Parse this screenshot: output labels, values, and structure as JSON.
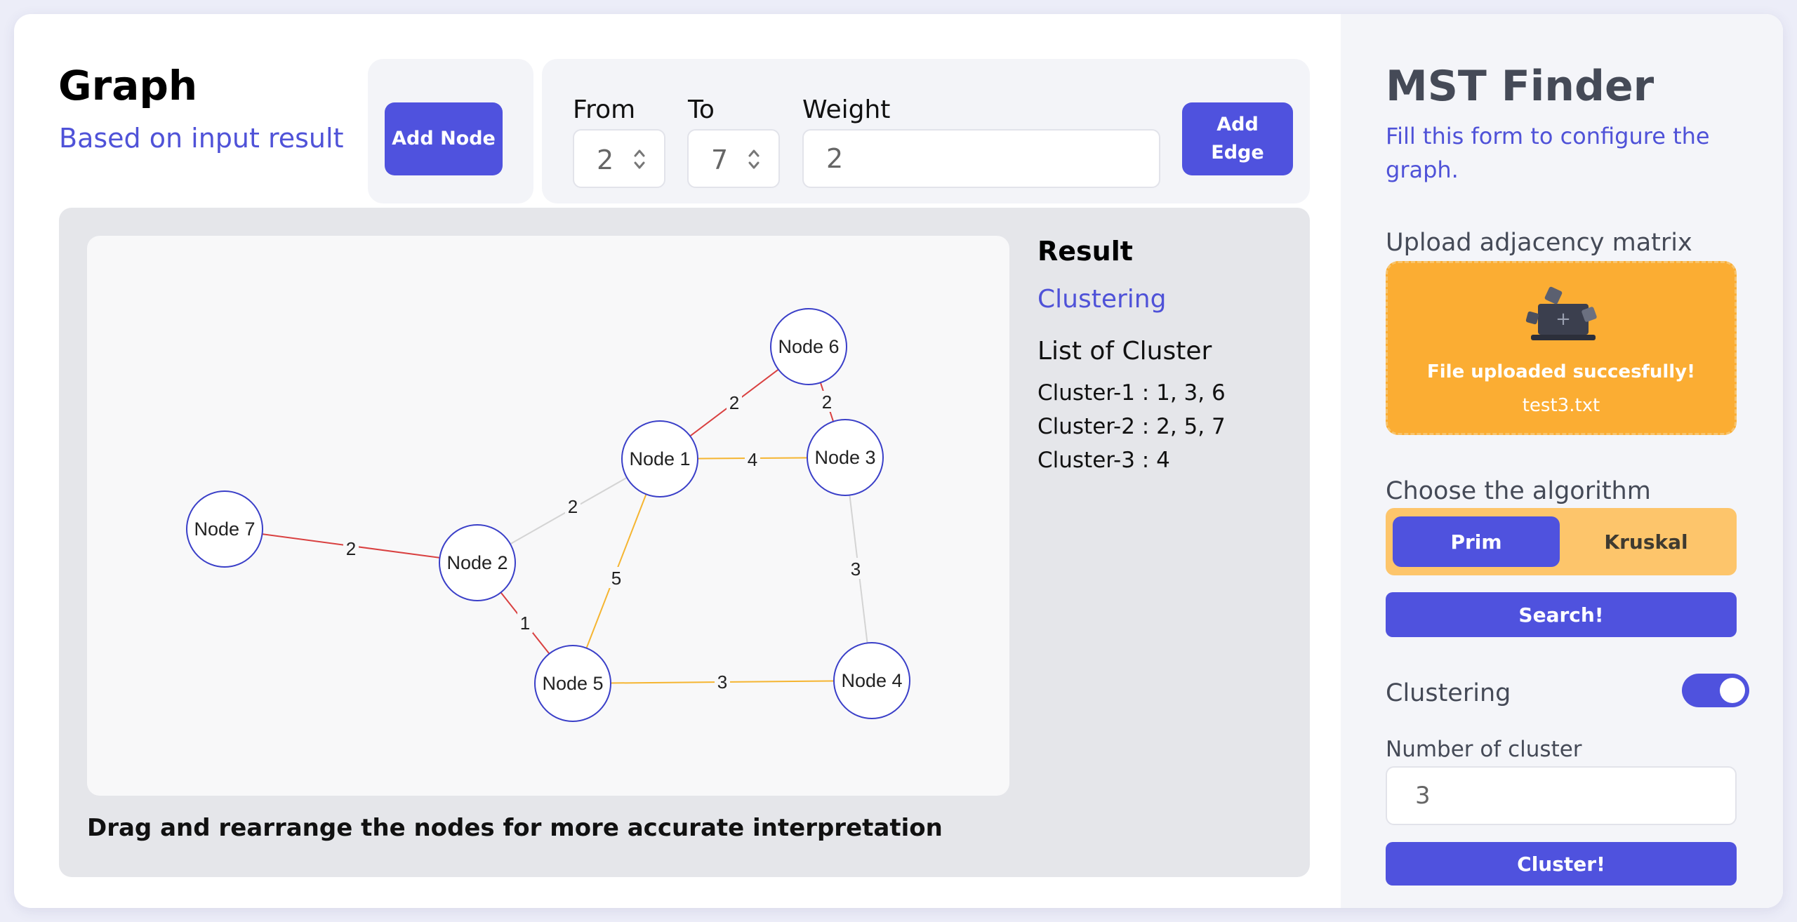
{
  "header": {
    "title": "Graph",
    "subtitle": "Based on input result",
    "add_node_label": "Add Node",
    "add_edge_label": "Add Edge",
    "from_label": "From",
    "to_label": "To",
    "weight_label": "Weight",
    "from_value": "2",
    "to_value": "7",
    "weight_value": "2"
  },
  "graph": {
    "hint": "Drag and rearrange the nodes for more accurate interpretation",
    "nodes": [
      "Node 1",
      "Node 2",
      "Node 3",
      "Node 4",
      "Node 5",
      "Node 6",
      "Node 7"
    ],
    "edges": [
      {
        "from": "Node 1",
        "to": "Node 6",
        "weight": "2",
        "color": "#d94040"
      },
      {
        "from": "Node 6",
        "to": "Node 3",
        "weight": "2",
        "color": "#d94040"
      },
      {
        "from": "Node 1",
        "to": "Node 3",
        "weight": "4",
        "color": "#f5b531"
      },
      {
        "from": "Node 1",
        "to": "Node 2",
        "weight": "2",
        "color": "#d4d4d4"
      },
      {
        "from": "Node 1",
        "to": "Node 5",
        "weight": "5",
        "color": "#f5b531"
      },
      {
        "from": "Node 7",
        "to": "Node 2",
        "weight": "2",
        "color": "#d94040"
      },
      {
        "from": "Node 2",
        "to": "Node 5",
        "weight": "1",
        "color": "#d94040"
      },
      {
        "from": "Node 3",
        "to": "Node 4",
        "weight": "3",
        "color": "#d4d4d4"
      },
      {
        "from": "Node 5",
        "to": "Node 4",
        "weight": "3",
        "color": "#f5b531"
      }
    ],
    "node_border_color": "#3a3fc8"
  },
  "result": {
    "title": "Result",
    "mode": "Clustering",
    "list_heading": "List of Cluster",
    "clusters": [
      "Cluster-1 : 1, 3, 6",
      "Cluster-2 : 2, 5, 7",
      "Cluster-3 : 4"
    ]
  },
  "sidebar": {
    "title": "MST Finder",
    "subtitle": "Fill this form to configure the graph.",
    "upload_label": "Upload adjacency matrix",
    "upload_message": "File uploaded succesfully!",
    "upload_filename": "test3.txt",
    "upload_icon": "laptop-upload-icon",
    "algorithm_label": "Choose the algorithm",
    "algorithms": [
      "Prim",
      "Kruskal"
    ],
    "selected_algorithm": "Prim",
    "search_label": "Search!",
    "clustering_label": "Clustering",
    "clustering_enabled": true,
    "num_cluster_label": "Number of cluster",
    "num_cluster_value": "3",
    "cluster_button_label": "Cluster!"
  },
  "colors": {
    "accent": "#4f52de",
    "upload_bg": "#fbad33",
    "toggle_bg": "#fdc56b",
    "mst_edge": "#d94040",
    "cluster_edge": "#f5b531",
    "removed_edge": "#d4d4d4"
  }
}
